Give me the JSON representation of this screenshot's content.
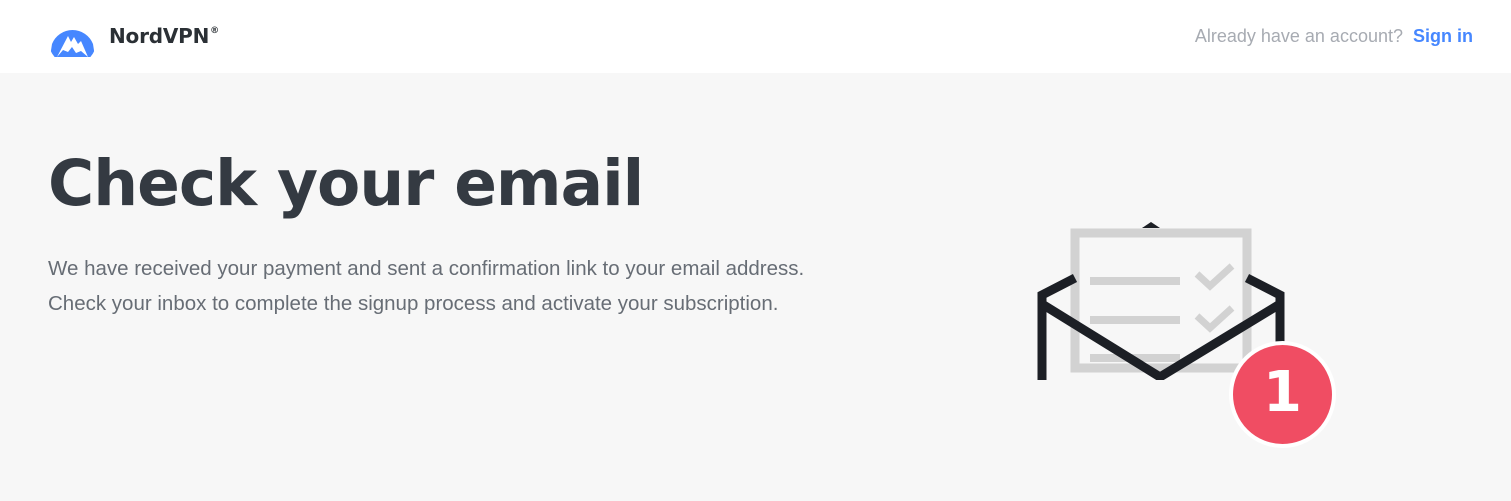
{
  "header": {
    "brand_name": "NordVPN",
    "brand_reg": "®",
    "account_prompt": "Already have an account?",
    "signin_label": "Sign in"
  },
  "main": {
    "title": "Check your email",
    "message": "We have received your payment and sent a confirmation link to your email address. Check your inbox to complete the signup process and activate your subscription."
  },
  "illustration": {
    "icon": "envelope-with-letter-icon",
    "badge_count": "1",
    "badge_color": "#f04d63"
  },
  "colors": {
    "accent_link": "#4687ff",
    "brand_logo": "#4687ff",
    "heading": "#343a42",
    "body_text": "#676d75",
    "muted": "#a7abb2",
    "background": "#f7f7f7"
  }
}
